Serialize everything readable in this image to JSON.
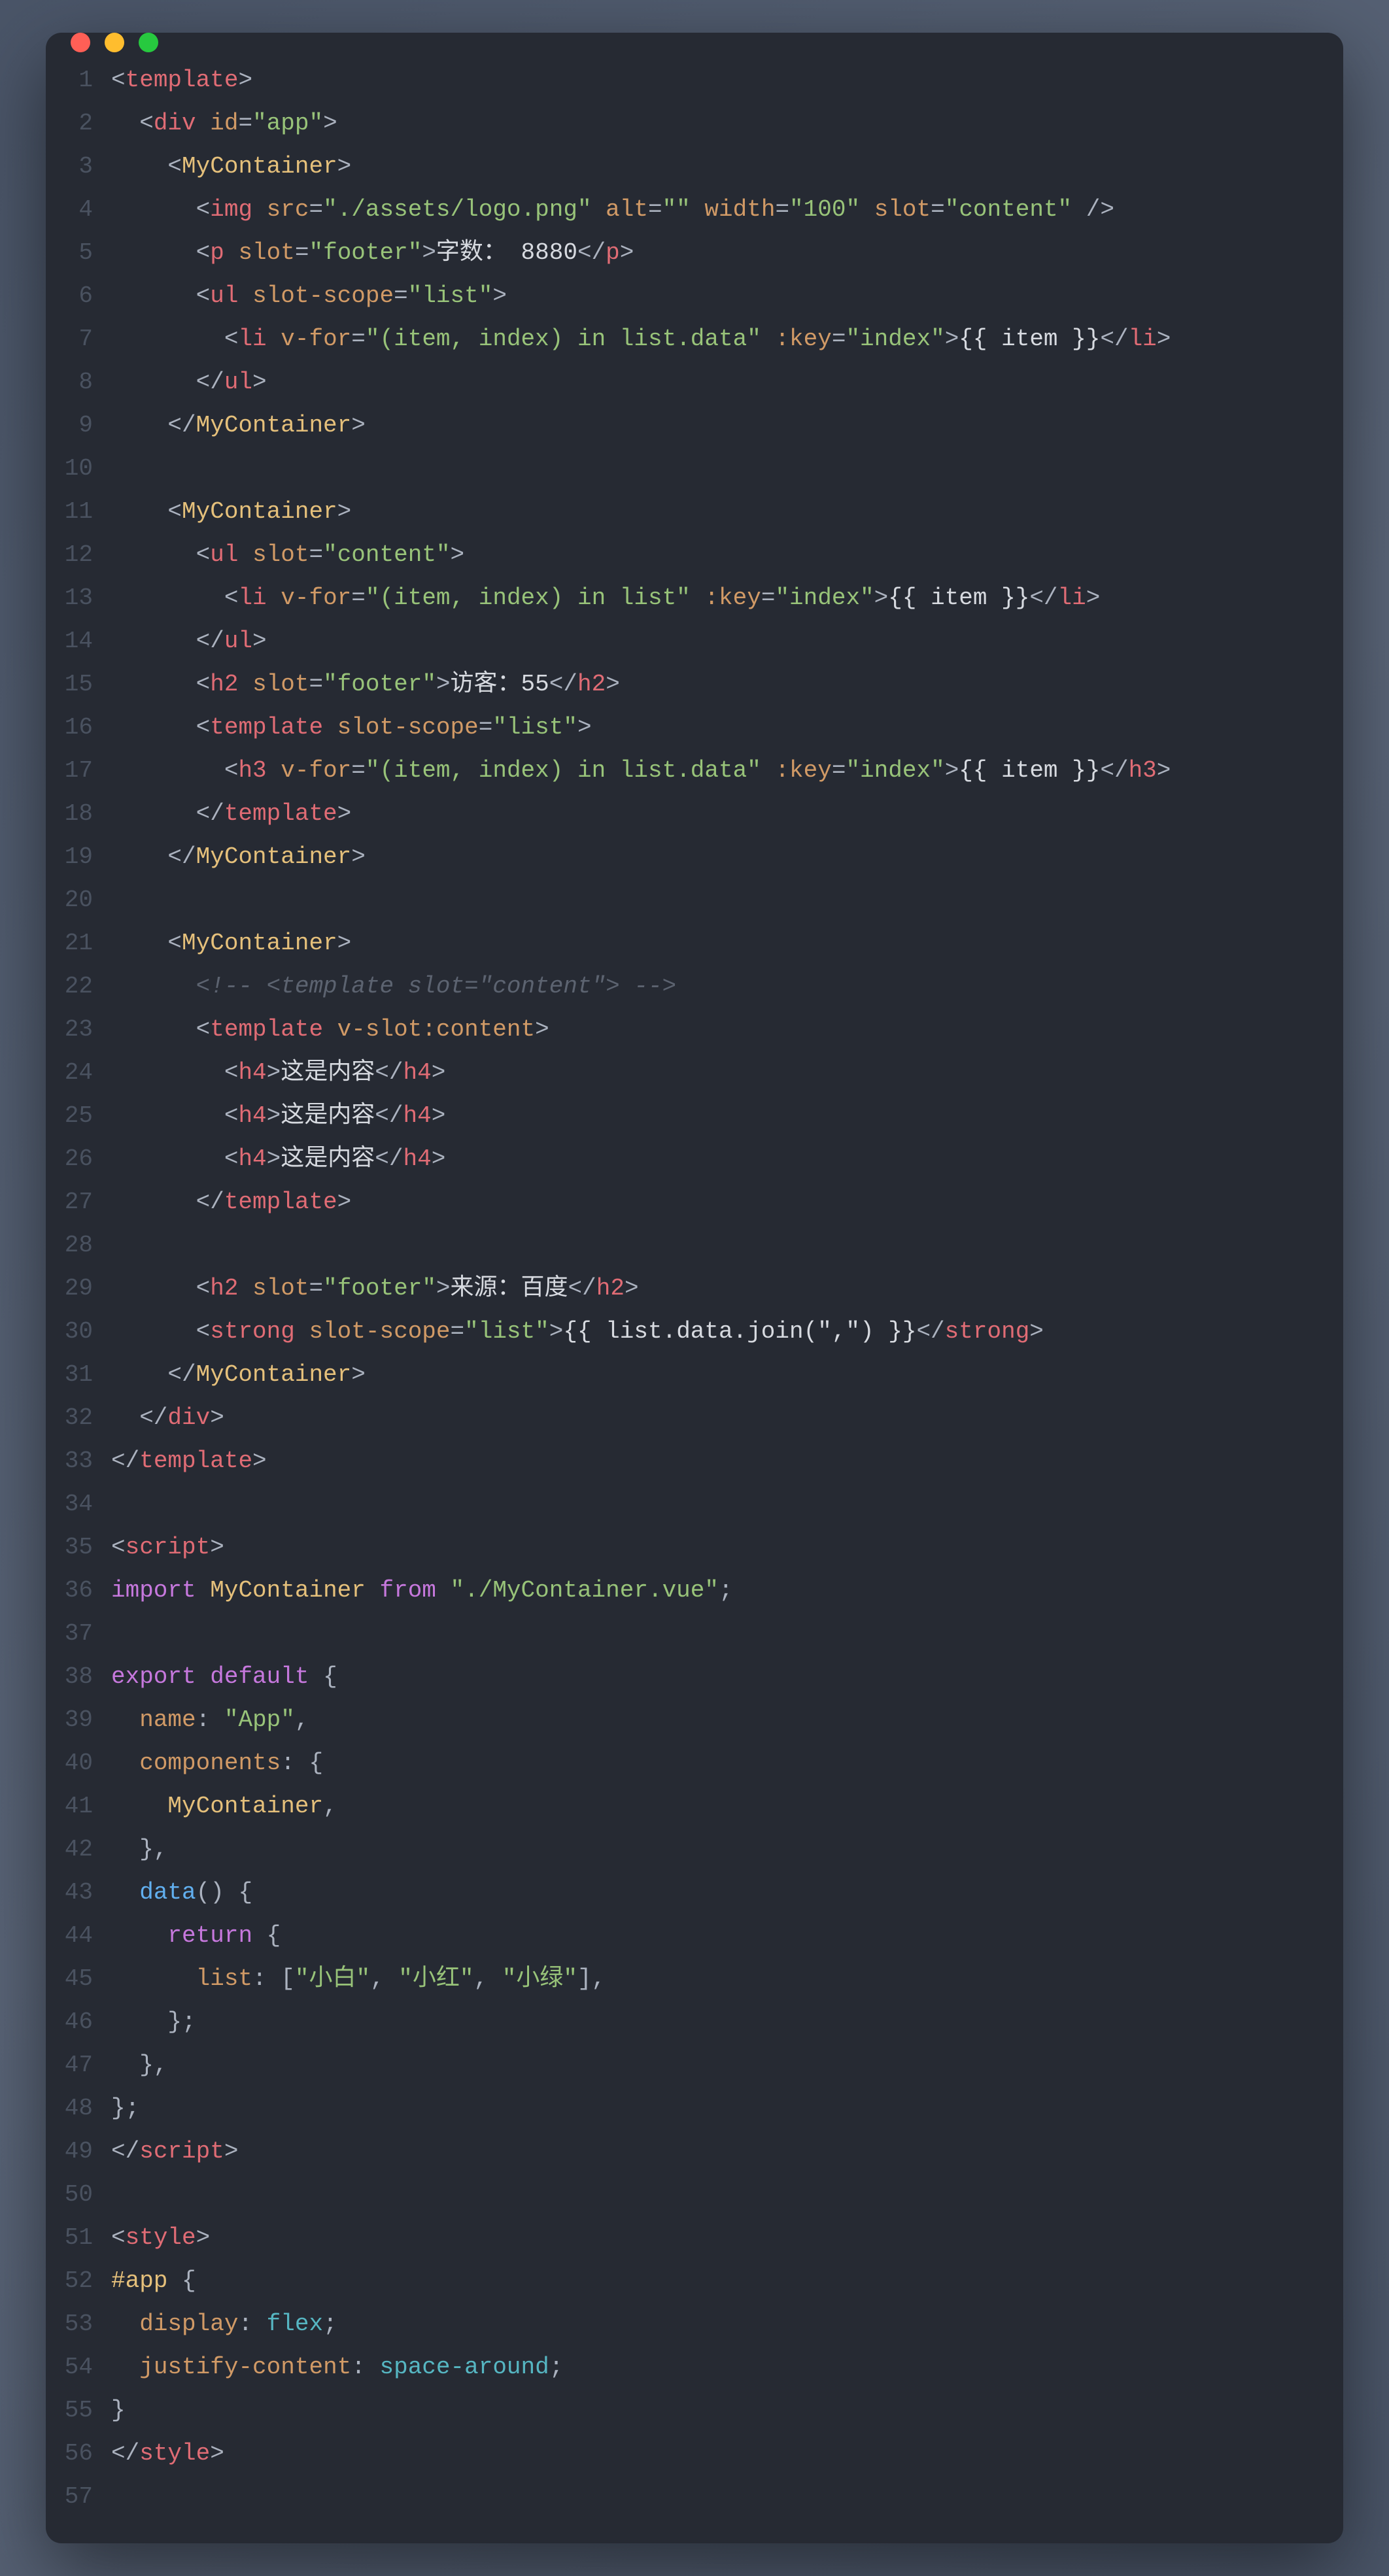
{
  "window": {
    "traffic_lights": [
      "close",
      "minimize",
      "zoom"
    ]
  },
  "line_count": 57,
  "code_lines": [
    [
      [
        "p",
        "<"
      ],
      [
        "t",
        "template"
      ],
      [
        "p",
        ">"
      ]
    ],
    [
      [
        "p",
        "  <"
      ],
      [
        "t",
        "div"
      ],
      [
        "p",
        " "
      ],
      [
        "a",
        "id"
      ],
      [
        "p",
        "="
      ],
      [
        "s",
        "\"app\""
      ],
      [
        "p",
        ">"
      ]
    ],
    [
      [
        "p",
        "    <"
      ],
      [
        "n",
        "MyContainer"
      ],
      [
        "p",
        ">"
      ]
    ],
    [
      [
        "p",
        "      <"
      ],
      [
        "t",
        "img"
      ],
      [
        "p",
        " "
      ],
      [
        "a",
        "src"
      ],
      [
        "p",
        "="
      ],
      [
        "s",
        "\"./assets/logo.png\""
      ],
      [
        "p",
        " "
      ],
      [
        "a",
        "alt"
      ],
      [
        "p",
        "="
      ],
      [
        "s",
        "\"\""
      ],
      [
        "p",
        " "
      ],
      [
        "a",
        "width"
      ],
      [
        "p",
        "="
      ],
      [
        "s",
        "\"100\""
      ],
      [
        "p",
        " "
      ],
      [
        "a",
        "slot"
      ],
      [
        "p",
        "="
      ],
      [
        "s",
        "\"content\""
      ],
      [
        "p",
        " />"
      ]
    ],
    [
      [
        "p",
        "      <"
      ],
      [
        "t",
        "p"
      ],
      [
        "p",
        " "
      ],
      [
        "a",
        "slot"
      ],
      [
        "p",
        "="
      ],
      [
        "s",
        "\"footer\""
      ],
      [
        "p",
        ">"
      ],
      [
        "tx",
        "字数： 8880"
      ],
      [
        "p",
        "</"
      ],
      [
        "t",
        "p"
      ],
      [
        "p",
        ">"
      ]
    ],
    [
      [
        "p",
        "      <"
      ],
      [
        "t",
        "ul"
      ],
      [
        "p",
        " "
      ],
      [
        "a",
        "slot-scope"
      ],
      [
        "p",
        "="
      ],
      [
        "s",
        "\"list\""
      ],
      [
        "p",
        ">"
      ]
    ],
    [
      [
        "p",
        "        <"
      ],
      [
        "t",
        "li"
      ],
      [
        "p",
        " "
      ],
      [
        "a",
        "v-for"
      ],
      [
        "p",
        "="
      ],
      [
        "s",
        "\"(item, index) in list.data\""
      ],
      [
        "p",
        " "
      ],
      [
        "a",
        ":key"
      ],
      [
        "p",
        "="
      ],
      [
        "s",
        "\"index\""
      ],
      [
        "p",
        ">"
      ],
      [
        "tx",
        "{{ item }}"
      ],
      [
        "p",
        "</"
      ],
      [
        "t",
        "li"
      ],
      [
        "p",
        ">"
      ]
    ],
    [
      [
        "p",
        "      </"
      ],
      [
        "t",
        "ul"
      ],
      [
        "p",
        ">"
      ]
    ],
    [
      [
        "p",
        "    </"
      ],
      [
        "n",
        "MyContainer"
      ],
      [
        "p",
        ">"
      ]
    ],
    [],
    [
      [
        "p",
        "    <"
      ],
      [
        "n",
        "MyContainer"
      ],
      [
        "p",
        ">"
      ]
    ],
    [
      [
        "p",
        "      <"
      ],
      [
        "t",
        "ul"
      ],
      [
        "p",
        " "
      ],
      [
        "a",
        "slot"
      ],
      [
        "p",
        "="
      ],
      [
        "s",
        "\"content\""
      ],
      [
        "p",
        ">"
      ]
    ],
    [
      [
        "p",
        "        <"
      ],
      [
        "t",
        "li"
      ],
      [
        "p",
        " "
      ],
      [
        "a",
        "v-for"
      ],
      [
        "p",
        "="
      ],
      [
        "s",
        "\"(item, index) in list\""
      ],
      [
        "p",
        " "
      ],
      [
        "a",
        ":key"
      ],
      [
        "p",
        "="
      ],
      [
        "s",
        "\"index\""
      ],
      [
        "p",
        ">"
      ],
      [
        "tx",
        "{{ item }}"
      ],
      [
        "p",
        "</"
      ],
      [
        "t",
        "li"
      ],
      [
        "p",
        ">"
      ]
    ],
    [
      [
        "p",
        "      </"
      ],
      [
        "t",
        "ul"
      ],
      [
        "p",
        ">"
      ]
    ],
    [
      [
        "p",
        "      <"
      ],
      [
        "t",
        "h2"
      ],
      [
        "p",
        " "
      ],
      [
        "a",
        "slot"
      ],
      [
        "p",
        "="
      ],
      [
        "s",
        "\"footer\""
      ],
      [
        "p",
        ">"
      ],
      [
        "tx",
        "访客：55"
      ],
      [
        "p",
        "</"
      ],
      [
        "t",
        "h2"
      ],
      [
        "p",
        ">"
      ]
    ],
    [
      [
        "p",
        "      <"
      ],
      [
        "t",
        "template"
      ],
      [
        "p",
        " "
      ],
      [
        "a",
        "slot-scope"
      ],
      [
        "p",
        "="
      ],
      [
        "s",
        "\"list\""
      ],
      [
        "p",
        ">"
      ]
    ],
    [
      [
        "p",
        "        <"
      ],
      [
        "t",
        "h3"
      ],
      [
        "p",
        " "
      ],
      [
        "a",
        "v-for"
      ],
      [
        "p",
        "="
      ],
      [
        "s",
        "\"(item, index) in list.data\""
      ],
      [
        "p",
        " "
      ],
      [
        "a",
        ":key"
      ],
      [
        "p",
        "="
      ],
      [
        "s",
        "\"index\""
      ],
      [
        "p",
        ">"
      ],
      [
        "tx",
        "{{ item }}"
      ],
      [
        "p",
        "</"
      ],
      [
        "t",
        "h3"
      ],
      [
        "p",
        ">"
      ]
    ],
    [
      [
        "p",
        "      </"
      ],
      [
        "t",
        "template"
      ],
      [
        "p",
        ">"
      ]
    ],
    [
      [
        "p",
        "    </"
      ],
      [
        "n",
        "MyContainer"
      ],
      [
        "p",
        ">"
      ]
    ],
    [],
    [
      [
        "p",
        "    <"
      ],
      [
        "n",
        "MyContainer"
      ],
      [
        "p",
        ">"
      ]
    ],
    [
      [
        "p",
        "      "
      ],
      [
        "c",
        "<!-- <template slot=\"content\"> -->"
      ]
    ],
    [
      [
        "p",
        "      <"
      ],
      [
        "t",
        "template"
      ],
      [
        "p",
        " "
      ],
      [
        "a",
        "v-slot:content"
      ],
      [
        "p",
        ">"
      ]
    ],
    [
      [
        "p",
        "        <"
      ],
      [
        "t",
        "h4"
      ],
      [
        "p",
        ">"
      ],
      [
        "tx",
        "这是内容"
      ],
      [
        "p",
        "</"
      ],
      [
        "t",
        "h4"
      ],
      [
        "p",
        ">"
      ]
    ],
    [
      [
        "p",
        "        <"
      ],
      [
        "t",
        "h4"
      ],
      [
        "p",
        ">"
      ],
      [
        "tx",
        "这是内容"
      ],
      [
        "p",
        "</"
      ],
      [
        "t",
        "h4"
      ],
      [
        "p",
        ">"
      ]
    ],
    [
      [
        "p",
        "        <"
      ],
      [
        "t",
        "h4"
      ],
      [
        "p",
        ">"
      ],
      [
        "tx",
        "这是内容"
      ],
      [
        "p",
        "</"
      ],
      [
        "t",
        "h4"
      ],
      [
        "p",
        ">"
      ]
    ],
    [
      [
        "p",
        "      </"
      ],
      [
        "t",
        "template"
      ],
      [
        "p",
        ">"
      ]
    ],
    [],
    [
      [
        "p",
        "      <"
      ],
      [
        "t",
        "h2"
      ],
      [
        "p",
        " "
      ],
      [
        "a",
        "slot"
      ],
      [
        "p",
        "="
      ],
      [
        "s",
        "\"footer\""
      ],
      [
        "p",
        ">"
      ],
      [
        "tx",
        "来源：百度"
      ],
      [
        "p",
        "</"
      ],
      [
        "t",
        "h2"
      ],
      [
        "p",
        ">"
      ]
    ],
    [
      [
        "p",
        "      <"
      ],
      [
        "t",
        "strong"
      ],
      [
        "p",
        " "
      ],
      [
        "a",
        "slot-scope"
      ],
      [
        "p",
        "="
      ],
      [
        "s",
        "\"list\""
      ],
      [
        "p",
        ">"
      ],
      [
        "tx",
        "{{ list.data.join(\",\") }}"
      ],
      [
        "p",
        "</"
      ],
      [
        "t",
        "strong"
      ],
      [
        "p",
        ">"
      ]
    ],
    [
      [
        "p",
        "    </"
      ],
      [
        "n",
        "MyContainer"
      ],
      [
        "p",
        ">"
      ]
    ],
    [
      [
        "p",
        "  </"
      ],
      [
        "t",
        "div"
      ],
      [
        "p",
        ">"
      ]
    ],
    [
      [
        "p",
        "</"
      ],
      [
        "t",
        "template"
      ],
      [
        "p",
        ">"
      ]
    ],
    [],
    [
      [
        "p",
        "<"
      ],
      [
        "t",
        "script"
      ],
      [
        "p",
        ">"
      ]
    ],
    [
      [
        "k",
        "import"
      ],
      [
        "p",
        " "
      ],
      [
        "n",
        "MyContainer"
      ],
      [
        "p",
        " "
      ],
      [
        "k",
        "from"
      ],
      [
        "p",
        " "
      ],
      [
        "s",
        "\"./MyContainer.vue\""
      ],
      [
        "p",
        ";"
      ]
    ],
    [],
    [
      [
        "k",
        "export"
      ],
      [
        "p",
        " "
      ],
      [
        "k",
        "default"
      ],
      [
        "p",
        " {"
      ]
    ],
    [
      [
        "p",
        "  "
      ],
      [
        "a",
        "name"
      ],
      [
        "p",
        ": "
      ],
      [
        "s",
        "\"App\""
      ],
      [
        "p",
        ","
      ]
    ],
    [
      [
        "p",
        "  "
      ],
      [
        "a",
        "components"
      ],
      [
        "p",
        ": {"
      ]
    ],
    [
      [
        "p",
        "    "
      ],
      [
        "n",
        "MyContainer"
      ],
      [
        "p",
        ","
      ]
    ],
    [
      [
        "p",
        "  },"
      ]
    ],
    [
      [
        "p",
        "  "
      ],
      [
        "f",
        "data"
      ],
      [
        "p",
        "() {"
      ]
    ],
    [
      [
        "p",
        "    "
      ],
      [
        "k",
        "return"
      ],
      [
        "p",
        " {"
      ]
    ],
    [
      [
        "p",
        "      "
      ],
      [
        "a",
        "list"
      ],
      [
        "p",
        ": ["
      ],
      [
        "s",
        "\"小白\""
      ],
      [
        "p",
        ", "
      ],
      [
        "s",
        "\"小红\""
      ],
      [
        "p",
        ", "
      ],
      [
        "s",
        "\"小绿\""
      ],
      [
        "p",
        "],"
      ]
    ],
    [
      [
        "p",
        "    };"
      ]
    ],
    [
      [
        "p",
        "  },"
      ]
    ],
    [
      [
        "p",
        "};"
      ]
    ],
    [
      [
        "p",
        "</"
      ],
      [
        "t",
        "script"
      ],
      [
        "p",
        ">"
      ]
    ],
    [],
    [
      [
        "p",
        "<"
      ],
      [
        "t",
        "style"
      ],
      [
        "p",
        ">"
      ]
    ],
    [
      [
        "n",
        "#app"
      ],
      [
        "p",
        " {"
      ]
    ],
    [
      [
        "p",
        "  "
      ],
      [
        "a",
        "display"
      ],
      [
        "p",
        ": "
      ],
      [
        "o",
        "flex"
      ],
      [
        "p",
        ";"
      ]
    ],
    [
      [
        "p",
        "  "
      ],
      [
        "a",
        "justify-content"
      ],
      [
        "p",
        ": "
      ],
      [
        "o",
        "space-around"
      ],
      [
        "p",
        ";"
      ]
    ],
    [
      [
        "p",
        "}"
      ]
    ],
    [
      [
        "p",
        "</"
      ],
      [
        "t",
        "style"
      ],
      [
        "p",
        ">"
      ]
    ],
    []
  ]
}
